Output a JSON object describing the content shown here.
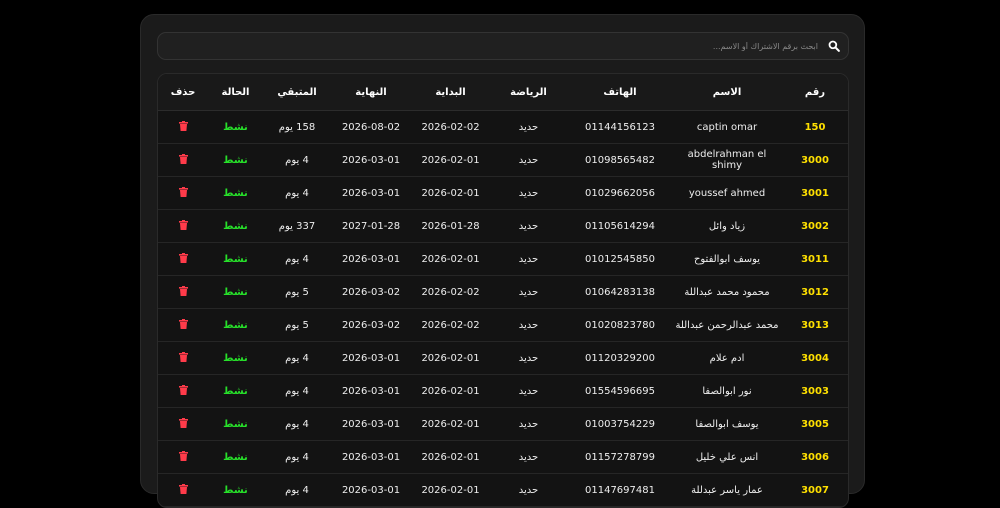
{
  "search": {
    "placeholder": "ابحث برقم الاشتراك أو الاسم..."
  },
  "headers": [
    "رقم",
    "الاسم",
    "الهاتف",
    "الرياضة",
    "البداية",
    "النهاية",
    "المتبقي",
    "الحالة",
    "حذف"
  ],
  "rows": [
    {
      "id": "150",
      "name": "captin omar",
      "phone": "01144156123",
      "sport": "حديد",
      "start": "2026-02-02",
      "end": "2026-08-02",
      "remaining": "158 يوم",
      "status": "نشط"
    },
    {
      "id": "3000",
      "name": "abdelrahman el shimy",
      "phone": "01098565482",
      "sport": "حديد",
      "start": "2026-02-01",
      "end": "2026-03-01",
      "remaining": "4 يوم",
      "status": "نشط"
    },
    {
      "id": "3001",
      "name": "youssef ahmed",
      "phone": "01029662056",
      "sport": "حديد",
      "start": "2026-02-01",
      "end": "2026-03-01",
      "remaining": "4 يوم",
      "status": "نشط"
    },
    {
      "id": "3002",
      "name": "زياد وائل",
      "phone": "01105614294",
      "sport": "حديد",
      "start": "2026-01-28",
      "end": "2027-01-28",
      "remaining": "337 يوم",
      "status": "نشط"
    },
    {
      "id": "3011",
      "name": "يوسف ابوالفتوح",
      "phone": "01012545850",
      "sport": "حديد",
      "start": "2026-02-01",
      "end": "2026-03-01",
      "remaining": "4 يوم",
      "status": "نشط"
    },
    {
      "id": "3012",
      "name": "محمود محمد عبداللة",
      "phone": "01064283138",
      "sport": "حديد",
      "start": "2026-02-02",
      "end": "2026-03-02",
      "remaining": "5 يوم",
      "status": "نشط"
    },
    {
      "id": "3013",
      "name": "محمد عبدالرحمن عبداللة",
      "phone": "01020823780",
      "sport": "حديد",
      "start": "2026-02-02",
      "end": "2026-03-02",
      "remaining": "5 يوم",
      "status": "نشط"
    },
    {
      "id": "3004",
      "name": "ادم علام",
      "phone": "01120329200",
      "sport": "حديد",
      "start": "2026-02-01",
      "end": "2026-03-01",
      "remaining": "4 يوم",
      "status": "نشط"
    },
    {
      "id": "3003",
      "name": "نور ابوالصفا",
      "phone": "01554596695",
      "sport": "حديد",
      "start": "2026-02-01",
      "end": "2026-03-01",
      "remaining": "4 يوم",
      "status": "نشط"
    },
    {
      "id": "3005",
      "name": "يوسف ابوالصفا",
      "phone": "01003754229",
      "sport": "حديد",
      "start": "2026-02-01",
      "end": "2026-03-01",
      "remaining": "4 يوم",
      "status": "نشط"
    },
    {
      "id": "3006",
      "name": "انس علي خليل",
      "phone": "01157278799",
      "sport": "حديد",
      "start": "2026-02-01",
      "end": "2026-03-01",
      "remaining": "4 يوم",
      "status": "نشط"
    },
    {
      "id": "3007",
      "name": "عمار ياسر عبدللة",
      "phone": "01147697481",
      "sport": "حديد",
      "start": "2026-02-01",
      "end": "2026-03-01",
      "remaining": "4 يوم",
      "status": "نشط"
    }
  ]
}
